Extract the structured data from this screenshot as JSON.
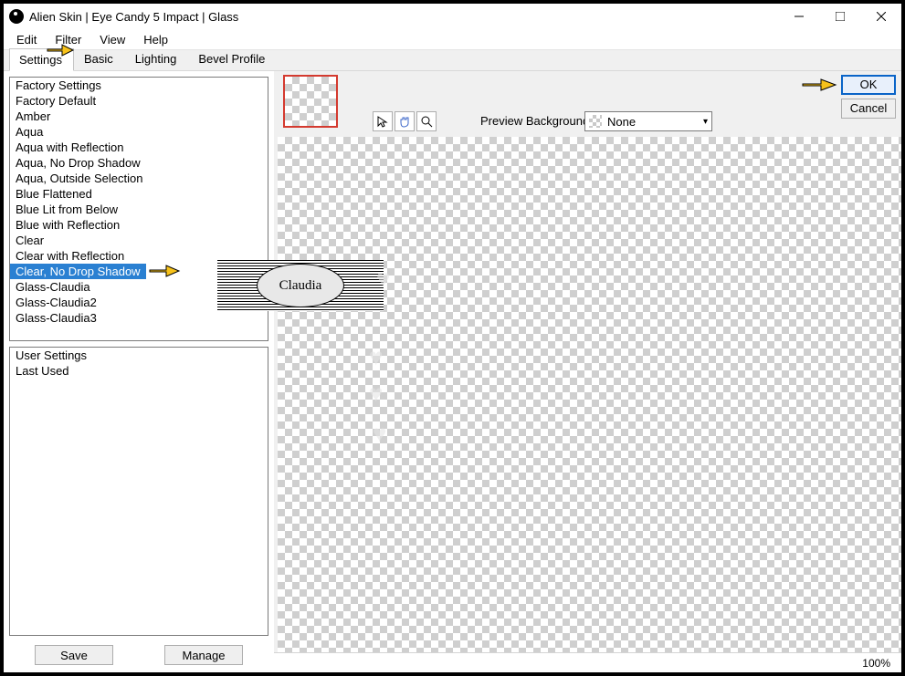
{
  "window": {
    "title": "Alien Skin | Eye Candy 5 Impact | Glass"
  },
  "menu": {
    "items": [
      "Edit",
      "Filter",
      "View",
      "Help"
    ]
  },
  "tabs": {
    "items": [
      "Settings",
      "Basic",
      "Lighting",
      "Bevel Profile"
    ],
    "active": 0
  },
  "factory": {
    "header": "Factory Settings",
    "items": [
      "Factory Default",
      "Amber",
      "Aqua",
      "Aqua with Reflection",
      "Aqua, No Drop Shadow",
      "Aqua, Outside Selection",
      "Blue Flattened",
      "Blue Lit from Below",
      "Blue with Reflection",
      "Clear",
      "Clear with Reflection",
      "Clear, No Drop Shadow",
      "Glass-Claudia",
      "Glass-Claudia2",
      "Glass-Claudia3"
    ],
    "selected": "Clear, No Drop Shadow"
  },
  "user": {
    "items": [
      "User Settings",
      "Last Used"
    ]
  },
  "buttons": {
    "save": "Save",
    "manage": "Manage",
    "ok": "OK",
    "cancel": "Cancel"
  },
  "preview": {
    "label": "Preview Background:",
    "value": "None"
  },
  "status": {
    "zoom": "100%"
  },
  "watermark": {
    "text": "Claudia"
  }
}
